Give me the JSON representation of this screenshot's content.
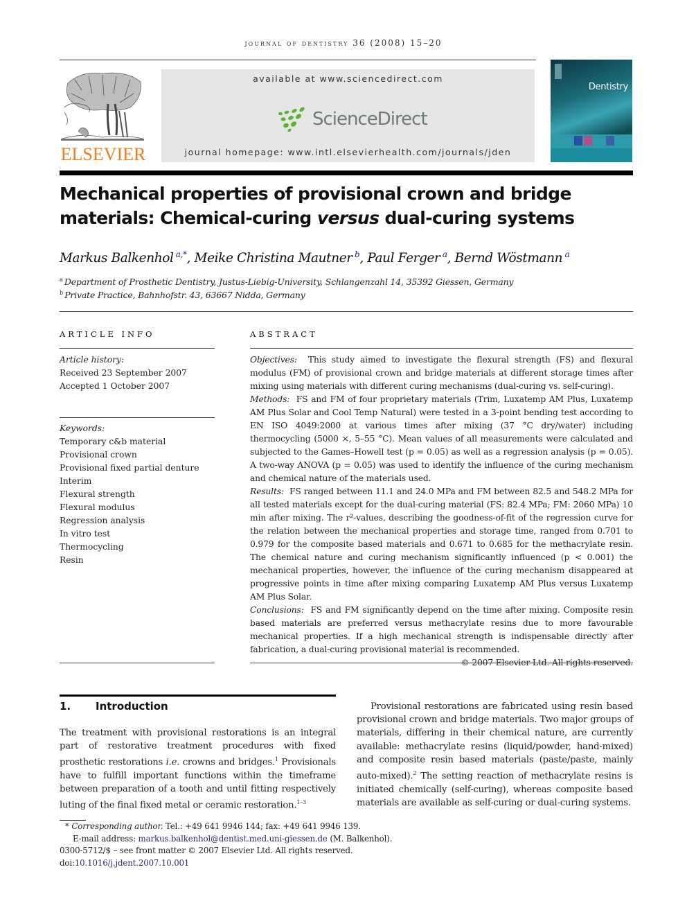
{
  "header": {
    "running_head": "journal of dentistry 36 (2008) 15–20",
    "publisher": "ELSEVIER",
    "available_at": "available at www.sciencedirect.com",
    "sciencedirect_brand": "ScienceDirect",
    "journal_homepage": "journal homepage: www.intl.elsevierhealth.com/journals/jden",
    "cover_title": "Dentistry",
    "colors": {
      "elsevier_orange": "#f07d19",
      "sciencedirect_green": "#5ab432",
      "sciencedirect_gray": "#6f7a7a",
      "cover_teal": "#1b8c9d",
      "link_blue": "#2a2a7a"
    }
  },
  "article": {
    "title_part1": "Mechanical properties of provisional crown and bridge materials: Chemical-curing ",
    "title_italic": "versus",
    "title_part2": " dual-curing systems",
    "authors": [
      {
        "name": "Markus Balkenhol",
        "sup": "a,*"
      },
      {
        "name": "Meike Christina Mautner",
        "sup": "b"
      },
      {
        "name": "Paul Ferger",
        "sup": "a"
      },
      {
        "name": "Bernd Wöstmann",
        "sup": "a"
      }
    ],
    "affiliations": [
      {
        "key": "a",
        "text": "Department of Prosthetic Dentistry, Justus-Liebig-University, Schlangenzahl 14, 35392 Giessen, Germany"
      },
      {
        "key": "b",
        "text": "Private Practice, Bahnhofstr. 43, 63667 Nidda, Germany"
      }
    ]
  },
  "article_info": {
    "heading": "ARTICLE INFO",
    "history_label": "Article history:",
    "received": "Received 23 September 2007",
    "accepted": "Accepted 1 October 2007",
    "keywords_label": "Keywords:",
    "keywords": [
      "Temporary c&b material",
      "Provisional crown",
      "Provisional fixed partial denture",
      "Interim",
      "Flexural strength",
      "Flexural modulus",
      "Regression analysis",
      "In vitro test",
      "Thermocycling",
      "Resin"
    ]
  },
  "abstract": {
    "heading": "ABSTRACT",
    "objectives_label": "Objectives:",
    "objectives_text": "This study aimed to investigate the flexural strength (FS) and flexural modulus (FM) of provisional crown and bridge materials at different storage times after mixing using materials with different curing mechanisms (dual-curing vs. self-curing).",
    "methods_label": "Methods:",
    "methods_text": "FS and FM of four proprietary materials (Trim, Luxatemp AM Plus, Luxatemp AM Plus Solar and Cool Temp Natural) were tested in a 3-point bending test according to EN ISO 4049:2000 at various times after mixing (37 °C dry/water) including thermocycling (5000 ×, 5–55 °C). Mean values of all measurements were calculated and subjected to the Games–Howell test (p = 0.05) as well as a regression analysis (p = 0.05). A two-way ANOVA (p = 0.05) was used to identify the influence of the curing mechanism and chemical nature of the materials used.",
    "results_label": "Results:",
    "results_text": "FS ranged between 11.1 and 24.0 MPa and FM between 82.5 and 548.2 MPa for all tested materials except for the dual-curing material (FS: 82.4 MPa; FM: 2060 MPa) 10 min after mixing. The r²-values, describing the goodness-of-fit of the regression curve for the relation between the mechanical properties and storage time, ranged from 0.701 to 0.979 for the composite based materials and 0.671 to 0.685 for the methacrylate resin. The chemical nature and curing mechanism significantly influenced (p < 0.001) the mechanical properties, however, the influence of the curing mechanism disappeared at progressive points in time after mixing comparing Luxatemp AM Plus versus Luxatemp AM Plus Solar.",
    "conclusions_label": "Conclusions:",
    "conclusions_text": "FS and FM significantly depend on the time after mixing. Composite resin based materials are preferred versus methacrylate resins due to more favourable mechanical properties. If a high mechanical strength is indispensable directly after fabrication, a dual-curing provisional material is recommended.",
    "copyright": "© 2007 Elsevier Ltd. All rights reserved."
  },
  "introduction": {
    "number": "1.",
    "heading": "Introduction",
    "para1_a": "The treatment with provisional restorations is an integral part of restorative treatment procedures with fixed prosthetic restorations ",
    "para1_ie": "i.e.",
    "para1_b": " crowns and bridges.",
    "para1_ref1": "1",
    "para1_c": " Provisionals have to fulfill important functions within the timeframe between preparation of a tooth and until fitting respectively luting of the final fixed metal or ceramic restoration.",
    "para1_ref2": "1–3",
    "para2_a": "Provisional restorations are fabricated using resin based provisional crown and bridge materials. Two major groups of materials, differing in their chemical nature, are currently available: methacrylate resins (liquid/powder, hand-mixed) and composite resin based materials (paste/paste, mainly auto-mixed).",
    "para2_ref": "2",
    "para2_b": " The setting reaction of methacrylate resins is initiated chemically (self-curing), whereas composite based materials are available as self-curing or dual-curing systems."
  },
  "footnotes": {
    "corresponding_mark": "*",
    "corresponding_label": "Corresponding author.",
    "corresponding_text": " Tel.: +49 641 9946 144; fax: +49 641 9946 139.",
    "email_label": "E-mail address: ",
    "email": "markus.balkenhol@dentist.med.uni-giessen.de",
    "email_suffix": " (M. Balkenhol).",
    "front_matter": "0300-5712/$ – see front matter © 2007 Elsevier Ltd. All rights reserved.",
    "doi_label": "doi:",
    "doi": "10.1016/j.jdent.2007.10.001"
  }
}
